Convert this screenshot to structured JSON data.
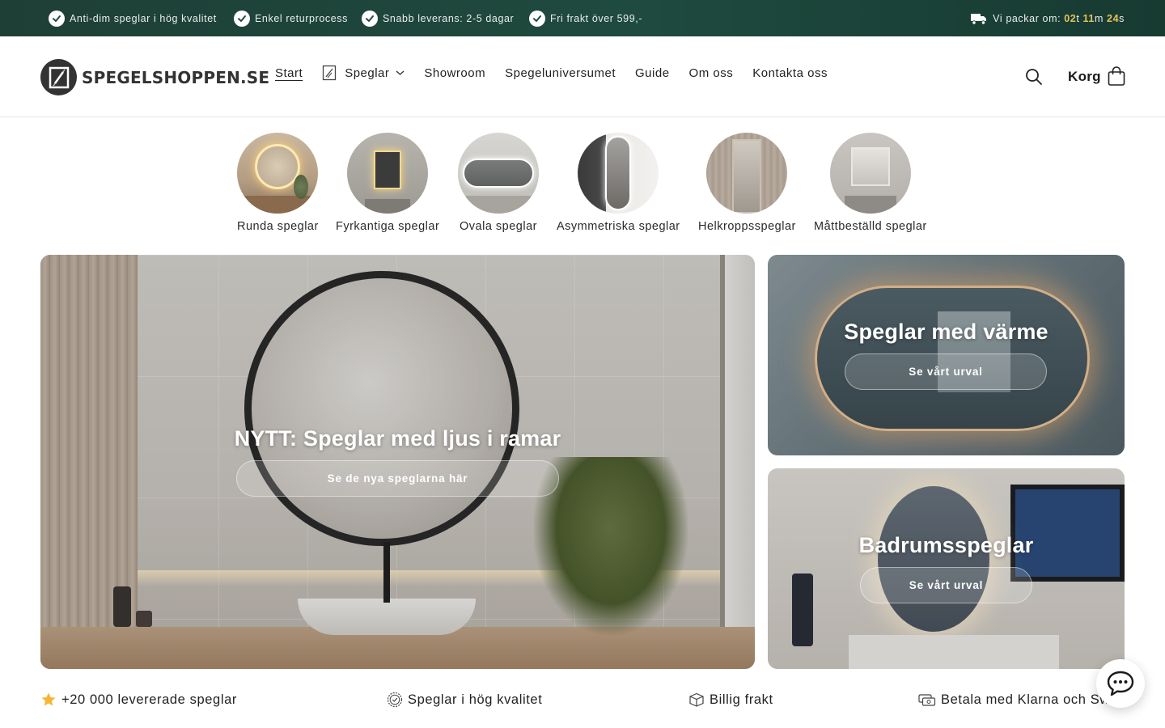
{
  "announcement": {
    "usps": [
      "Anti-dim speglar i hög kvalitet",
      "Enkel returprocess",
      "Snabb leverans: 2-5 dagar",
      "Fri frakt över 599,-"
    ],
    "packing_label": "Vi packar om: ",
    "countdown": {
      "hours": "02",
      "h_unit": "t",
      "minutes": "11",
      "m_unit": "m",
      "seconds": "24",
      "s_unit": "s"
    },
    "accent_color": "#e6c15a",
    "bar_color": "#1f4a3f"
  },
  "header": {
    "logo_text": "SPEGELSHOPPEN.SE",
    "nav": [
      "Start",
      "Speglar",
      "Showroom",
      "Spegeluniversumet",
      "Guide",
      "Om oss",
      "Kontakta oss"
    ],
    "active_nav": "Start",
    "search_icon": "search-icon",
    "cart_label": "Korg",
    "cart_icon": "shopping-bag-icon"
  },
  "categories": [
    {
      "label": "Runda speglar"
    },
    {
      "label": "Fyrkantiga speglar"
    },
    {
      "label": "Ovala speglar"
    },
    {
      "label": "Asymmetriska speglar"
    },
    {
      "label": "Helkroppsspeglar"
    },
    {
      "label": "Måttbeställd speglar"
    }
  ],
  "hero": {
    "main": {
      "title": "NYTT: Speglar med ljus i ramar",
      "cta": "Se de nya speglarna här"
    },
    "side_top": {
      "title": "Speglar med värme",
      "cta": "Se vårt urval"
    },
    "side_bottom": {
      "title": "Badrumsspeglar",
      "cta": "Se vårt urval"
    }
  },
  "trust": [
    {
      "icon": "star-icon",
      "text": "+20 000 levererade speglar"
    },
    {
      "icon": "quality-badge-icon",
      "text": "Speglar i hög kvalitet"
    },
    {
      "icon": "box-icon",
      "text": "Billig frakt"
    },
    {
      "icon": "payment-icon",
      "text": "Betala med Klarna och Sw"
    }
  ],
  "chat_icon": "chat-icon"
}
